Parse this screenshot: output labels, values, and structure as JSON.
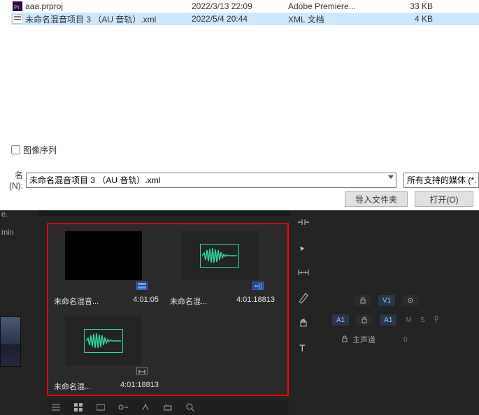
{
  "file_list": {
    "rows": [
      {
        "icon": "Pr",
        "name": "aaa.prproj",
        "date": "2022/3/13 22:09",
        "type": "Adobe Premiere...",
        "size": "33 KB",
        "selected": false
      },
      {
        "icon": "xml",
        "name": "未命名混音项目 3 （AU 音轨）.xml",
        "date": "2022/5/4 20:44",
        "type": "XML 文档",
        "size": "4 KB",
        "selected": true
      }
    ]
  },
  "image_sequence_checkbox": {
    "label": "图像序列",
    "checked": false
  },
  "filename_row": {
    "label": "名(N):",
    "value": "未命名混音项目 3 （AU 音轨）.xml"
  },
  "filetype_filter": {
    "value": "所有支持的媒体 (*."
  },
  "buttons": {
    "import_folder": "导入文件夹",
    "open": "打开(O)"
  },
  "left_panel": {
    "line1": "e.",
    "line2": "min"
  },
  "project_items": [
    {
      "name": "未命名混音...",
      "duration": "4:01:05",
      "kind": "sequence"
    },
    {
      "name": "未命名混...",
      "duration": "4:01:18813",
      "kind": "audio"
    },
    {
      "name": "未命名混...",
      "duration": "4:01:18813",
      "kind": "audio"
    }
  ],
  "timeline": {
    "video_row": {
      "lock": "🔒",
      "track": "V1",
      "eye": "👁"
    },
    "audio_row": {
      "a1_src": "A1",
      "lock": "🔒",
      "a1_dst": "A1",
      "m": "M",
      "s": "S"
    },
    "master": "主声道"
  }
}
